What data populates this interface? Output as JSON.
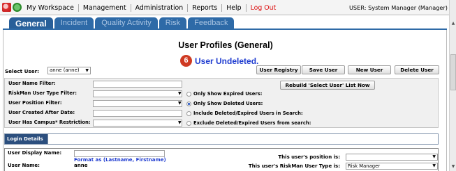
{
  "topbar": {
    "menu": [
      "My Workspace",
      "Management",
      "Administration",
      "Reports",
      "Help",
      "Log Out"
    ],
    "user_info": "USER: System Manager (Manager)"
  },
  "tabs": [
    "General",
    "Incident",
    "Quality Activity",
    "Risk",
    "Feedback"
  ],
  "page": {
    "title": "User Profiles (General)",
    "status_badge": "6",
    "status_message": "User Undeleted."
  },
  "select_user": {
    "label": "Select User:",
    "value": "anne (anne)"
  },
  "buttons": {
    "user_registry": "User Registry",
    "save_user": "Save User",
    "new_user": "New User",
    "delete_user": "Delete User",
    "rebuild": "Rebuild 'Select User' List Now"
  },
  "filters": {
    "user_name": "User Name Filter:",
    "riskman_type": "RiskMan User Type Filter:",
    "position": "User Position Filter:",
    "created_after": "User Created After Date:",
    "campus_restriction": "User Has Campus* Restriction:"
  },
  "radio_options": [
    {
      "label": "Only Show Expired Users:",
      "selected": false
    },
    {
      "label": "Only Show Deleted Users:",
      "selected": true
    },
    {
      "label": "Include Deleted/Expired Users in Search:",
      "selected": false
    },
    {
      "label": "Exclude Deleted/Expired Users from search:",
      "selected": false
    }
  ],
  "login_details": {
    "header": "Login Details",
    "display_name_label": "User Display Name:",
    "format_hint": "Format as (Lastname, Firstname)",
    "user_name_label": "User Name:",
    "user_name_value": "anne",
    "position_label": "This user's position is:",
    "position_value": "",
    "type_label": "This user's RiskMan User Type is:",
    "type_value": "Risk Manager"
  },
  "colors": {
    "tab_blue": "#2e6aa7",
    "status_blue": "#1f3cd0",
    "logout_red": "#dd1111",
    "badge_red": "#cf3a22"
  }
}
